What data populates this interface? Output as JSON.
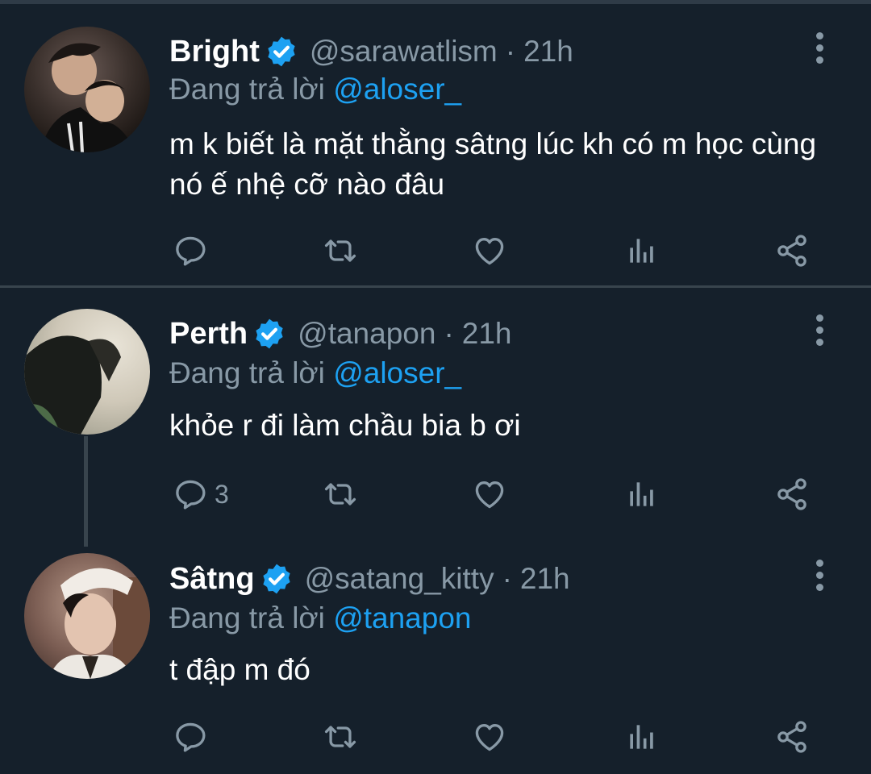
{
  "colors": {
    "background": "#15202b",
    "divider": "#38444d",
    "secondary_text": "#8899a6",
    "accent": "#1da1f2"
  },
  "tweets": [
    {
      "name": "Bright",
      "handle": "@sarawatlism",
      "separator": "·",
      "time": "21h",
      "reply_prefix": "Đang trả lời",
      "reply_to": "@aloser_",
      "text": "m k biết là mặt thằng sâtng lúc kh có m học cùng nó ế nhệ cỡ nào đâu",
      "reply_count": "",
      "verified": true,
      "icons": [
        "reply-icon",
        "retweet-icon",
        "like-icon",
        "analytics-icon",
        "share-icon"
      ]
    },
    {
      "name": "Perth",
      "handle": "@tanapon",
      "separator": "·",
      "time": "21h",
      "reply_prefix": "Đang trả lời",
      "reply_to": "@aloser_",
      "text": "khỏe r đi làm chầu bia b ơi",
      "reply_count": "3",
      "verified": true,
      "icons": [
        "reply-icon",
        "retweet-icon",
        "like-icon",
        "analytics-icon",
        "share-icon"
      ]
    },
    {
      "name": "Sâtng",
      "handle": "@satang_kitty",
      "separator": "·",
      "time": "21h",
      "reply_prefix": "Đang trả lời",
      "reply_to": "@tanapon",
      "text": "t đập m đó",
      "reply_count": "",
      "verified": true,
      "icons": [
        "reply-icon",
        "retweet-icon",
        "like-icon",
        "analytics-icon",
        "share-icon"
      ]
    }
  ]
}
